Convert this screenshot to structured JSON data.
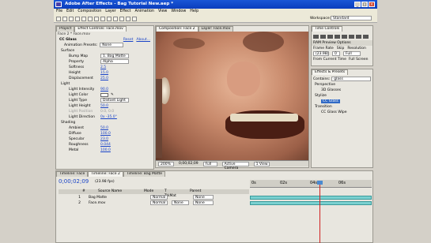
{
  "app": {
    "title": "Adobe After Effects - Bag Tutorial New.aep *"
  },
  "menu": [
    "File",
    "Edit",
    "Composition",
    "Layer",
    "Effect",
    "Animation",
    "View",
    "Window",
    "Help"
  ],
  "workspace": {
    "label": "Workspace:",
    "value": "Standard"
  },
  "project_panel": {
    "tabs": [
      "Project",
      "Effect Controls: Face.mov"
    ],
    "header": "Face 2 * Face.mov",
    "effect_name": "CC Glass",
    "reset_label": "Reset",
    "about_label": "About...",
    "anim_presets_label": "Animation Presets:",
    "anim_presets_value": "None",
    "groups": {
      "surface": "Surface",
      "light": "Light",
      "shading": "Shading"
    },
    "surface_rows": [
      {
        "label": "Bump Map",
        "value": "1. Bag Matte"
      },
      {
        "label": "Property",
        "value": "Alpha"
      },
      {
        "label": "Softness",
        "value": "2.5"
      },
      {
        "label": "Height",
        "value": "15.0"
      },
      {
        "label": "Displacement",
        "value": "25.0"
      }
    ],
    "light_rows": [
      {
        "label": "Light Intensity",
        "value": "90.0"
      },
      {
        "label": "Light Color",
        "value": ""
      },
      {
        "label": "Light Type",
        "value": "Distant Light"
      },
      {
        "label": "Light Height",
        "value": "50.0"
      },
      {
        "label": "Light Position",
        "value": "0.0, 0.0"
      },
      {
        "label": "Light Direction",
        "value": "0x -35.0°"
      }
    ],
    "shading_rows": [
      {
        "label": "Ambient",
        "value": "50.0"
      },
      {
        "label": "Diffuse",
        "value": "100.0"
      },
      {
        "label": "Specular",
        "value": "23.0"
      },
      {
        "label": "Roughness",
        "value": "0.044"
      },
      {
        "label": "Metal",
        "value": "100.0"
      }
    ]
  },
  "comp_panel": {
    "tabs": [
      "Composition: Face 2",
      "Layer: Face.mov"
    ],
    "active_tab": "Face 2",
    "footer": {
      "zoom": "200%",
      "timecode": "0;00;02;09",
      "quality": "Full",
      "camera": "Active Camera",
      "views": "1 View"
    }
  },
  "time_controls": {
    "title": "Time Controls",
    "ram_preview": "RAM Preview Options",
    "frame_rate_label": "Frame Rate",
    "frame_rate": "(23.98)",
    "skip_label": "Skip",
    "skip": "0",
    "resolution_label": "Resolution",
    "resolution": "Full",
    "from_current": "From Current Time",
    "full_screen": "Full Screen"
  },
  "effects_presets": {
    "title": "Effects & Presets",
    "contains_label": "Contains:",
    "search": "glass",
    "items": [
      "Perspective",
      "3D Glasses",
      "Stylize",
      "CC Glass",
      "Transition",
      "CC Glass Wipe"
    ]
  },
  "timeline": {
    "tabs": [
      "Timeline: Face",
      "Timeline: Face 2",
      "Timeline: Bag Matte"
    ],
    "timecode": "0;00;02;09",
    "fps": "(23.98 fps)",
    "columns": [
      "#",
      "Source Name",
      "Mode",
      "T TrkMat",
      "Parent"
    ],
    "layers": [
      {
        "num": "1",
        "name": "Bag Matte",
        "mode": "Normal",
        "trkmat": "",
        "parent": "None"
      },
      {
        "num": "2",
        "name": "Face.mov",
        "mode": "Normal",
        "trkmat": "None",
        "parent": "None"
      }
    ],
    "ruler": [
      "0s",
      "02s",
      "04s",
      "06s"
    ]
  }
}
